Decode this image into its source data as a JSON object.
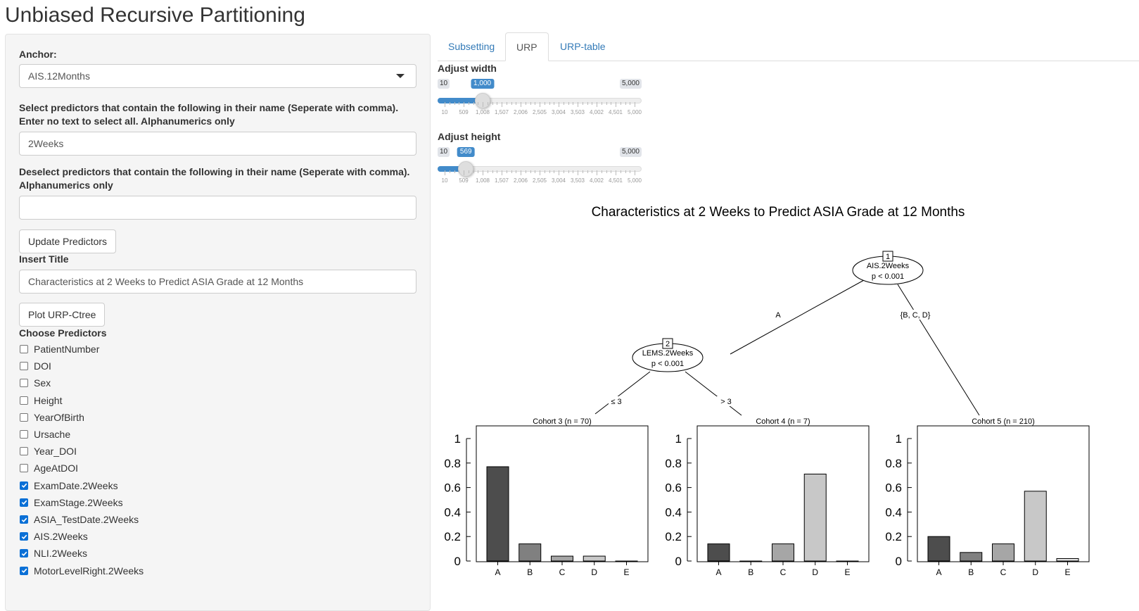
{
  "app": {
    "title": "Unbiased Recursive Partitioning"
  },
  "sidebar": {
    "anchor_label": "Anchor:",
    "anchor_value": "AIS.12Months",
    "select_label_line1": "Select predictors that contain the following in their name (Seperate with comma).",
    "select_label_line2": "Enter no text to select all. Alphanumerics only",
    "select_value": "2Weeks",
    "deselect_label_line1": "Deselect predictors that contain the following in their name (Seperate with comma).",
    "deselect_label_line2": "Alphanumerics only",
    "deselect_value": "",
    "update_button": "Update Predictors",
    "title_label": "Insert Title",
    "title_value": "Characteristics at 2 Weeks to Predict ASIA Grade at 12 Months",
    "plot_button": "Plot URP-Ctree",
    "choose_label": "Choose Predictors",
    "predictors": [
      {
        "label": "PatientNumber",
        "checked": false
      },
      {
        "label": "DOI",
        "checked": false
      },
      {
        "label": "Sex",
        "checked": false
      },
      {
        "label": "Height",
        "checked": false
      },
      {
        "label": "YearOfBirth",
        "checked": false
      },
      {
        "label": "Ursache",
        "checked": false
      },
      {
        "label": "Year_DOI",
        "checked": false
      },
      {
        "label": "AgeAtDOI",
        "checked": false
      },
      {
        "label": "ExamDate.2Weeks",
        "checked": true
      },
      {
        "label": "ExamStage.2Weeks",
        "checked": true
      },
      {
        "label": "ASIA_TestDate.2Weeks",
        "checked": true
      },
      {
        "label": "AIS.2Weeks",
        "checked": true
      },
      {
        "label": "NLI.2Weeks",
        "checked": true
      },
      {
        "label": "MotorLevelRight.2Weeks",
        "checked": true
      }
    ]
  },
  "tabs": [
    {
      "label": "Subsetting",
      "active": false
    },
    {
      "label": "URP",
      "active": true
    },
    {
      "label": "URP-table",
      "active": false
    }
  ],
  "sliders": {
    "width": {
      "label": "Adjust width",
      "min": 10,
      "max": 5000,
      "value": 1000,
      "min_text": "10",
      "max_text": "5,000",
      "value_text": "1,000"
    },
    "height": {
      "label": "Adjust height",
      "min": 10,
      "max": 5000,
      "value": 569,
      "min_text": "10",
      "max_text": "5,000",
      "value_text": "569"
    },
    "grid_labels": [
      "10",
      "509",
      "1,008",
      "1,507",
      "2,006",
      "2,505",
      "3,004",
      "3,503",
      "4,002",
      "4,501",
      "5,000"
    ]
  },
  "tree": {
    "title": "Characteristics at 2 Weeks to Predict ASIA Grade at 12 Months",
    "nodes": [
      {
        "id": "1",
        "var": "AIS.2Weeks",
        "p": "p < 0.001"
      },
      {
        "id": "2",
        "var": "LEMS.2Weeks",
        "p": "p < 0.001"
      }
    ],
    "edges": [
      {
        "label": "A"
      },
      {
        "label": "{B, C, D}"
      },
      {
        "label": "≤ 3"
      },
      {
        "label": "> 3"
      }
    ]
  },
  "chart_data": [
    {
      "type": "bar",
      "title": "Cohort 3 (n = 70)",
      "categories": [
        "A",
        "B",
        "C",
        "D",
        "E"
      ],
      "values": [
        0.77,
        0.14,
        0.04,
        0.04,
        0.0
      ],
      "ylim": [
        0,
        1
      ],
      "yticks": [
        "0",
        "0.2",
        "0.4",
        "0.6",
        "0.8",
        "1"
      ],
      "colors": [
        "#4d4d4d",
        "#808080",
        "#a6a6a6",
        "#c8c8c8",
        "#e6e6e6"
      ]
    },
    {
      "type": "bar",
      "title": "Cohort 4 (n = 7)",
      "categories": [
        "A",
        "B",
        "C",
        "D",
        "E"
      ],
      "values": [
        0.14,
        0.0,
        0.14,
        0.71,
        0.0
      ],
      "ylim": [
        0,
        1
      ],
      "yticks": [
        "0",
        "0.2",
        "0.4",
        "0.6",
        "0.8",
        "1"
      ],
      "colors": [
        "#4d4d4d",
        "#808080",
        "#a6a6a6",
        "#c8c8c8",
        "#e6e6e6"
      ]
    },
    {
      "type": "bar",
      "title": "Cohort 5 (n = 210)",
      "categories": [
        "A",
        "B",
        "C",
        "D",
        "E"
      ],
      "values": [
        0.2,
        0.07,
        0.14,
        0.57,
        0.02
      ],
      "ylim": [
        0,
        1
      ],
      "yticks": [
        "0",
        "0.2",
        "0.4",
        "0.6",
        "0.8",
        "1"
      ],
      "colors": [
        "#4d4d4d",
        "#808080",
        "#a6a6a6",
        "#c8c8c8",
        "#e6e6e6"
      ]
    }
  ]
}
